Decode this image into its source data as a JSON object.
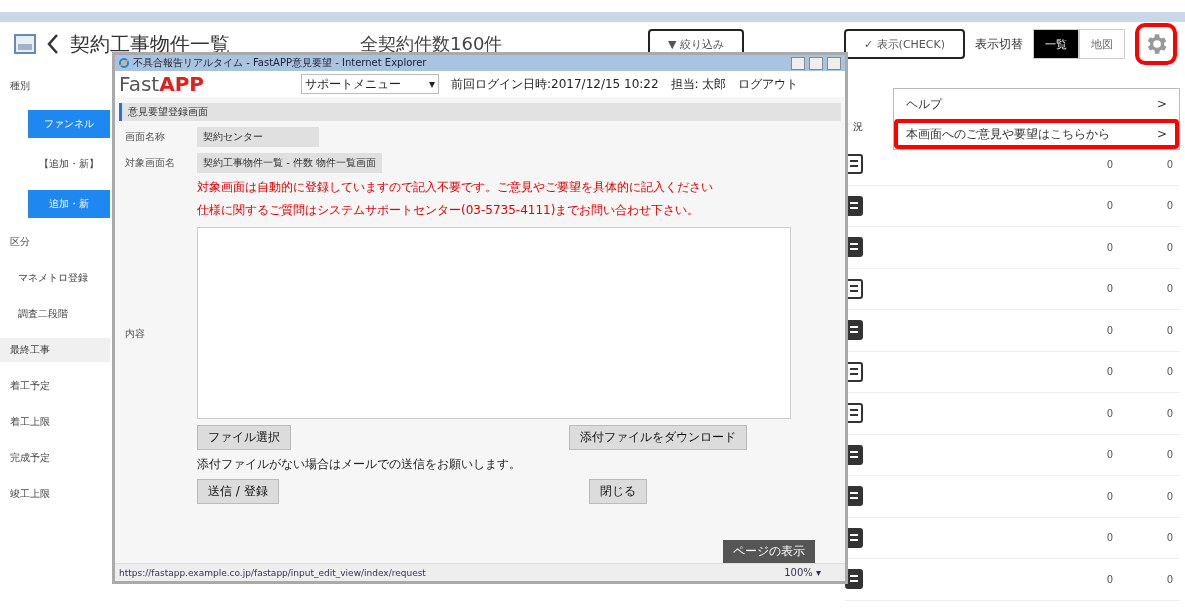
{
  "header": {
    "title": "契約工事物件一覧",
    "count": "全契約件数160件",
    "filter_button": "▼ 絞り込み",
    "check_button": "✓ 表示(CHECK)",
    "view_label": "表示切替",
    "view_options": [
      {
        "label": "一覧",
        "selected": true
      },
      {
        "label": "地図",
        "selected": false
      }
    ],
    "settings_highlighted": true
  },
  "sidebar": [
    {
      "kind": "heading",
      "label": "種別",
      "selected": false,
      "highlighted": false
    },
    {
      "kind": "option",
      "label": "ファンネル",
      "selected": true,
      "highlighted": false
    },
    {
      "kind": "option",
      "label": "【追加・新】",
      "selected": false,
      "highlighted": false
    },
    {
      "kind": "option",
      "label": "追加・新",
      "selected": true,
      "highlighted": false
    },
    {
      "kind": "heading",
      "label": "区分",
      "selected": false,
      "highlighted": false
    },
    {
      "kind": "sub",
      "label": "マネメトロ登録",
      "selected": false,
      "highlighted": false
    },
    {
      "kind": "sub",
      "label": "調査二段階",
      "selected": false,
      "highlighted": false
    },
    {
      "kind": "heading",
      "label": "最終工事",
      "selected": false,
      "highlighted": true
    },
    {
      "kind": "heading",
      "label": "着工予定",
      "selected": false,
      "highlighted": false
    },
    {
      "kind": "heading",
      "label": "着工上限",
      "selected": false,
      "highlighted": false
    },
    {
      "kind": "heading",
      "label": "完成予定",
      "selected": false,
      "highlighted": false
    },
    {
      "kind": "heading",
      "label": "竣工上限",
      "selected": false,
      "highlighted": false
    }
  ],
  "table": {
    "column_1": "況",
    "rows": [
      {
        "kind": "outline",
        "value_1": "0",
        "value_2": "0"
      },
      {
        "kind": "filled",
        "value_1": "0",
        "value_2": "0"
      },
      {
        "kind": "filled",
        "value_1": "0",
        "value_2": "0"
      },
      {
        "kind": "outline",
        "value_1": "0",
        "value_2": "0"
      },
      {
        "kind": "filled",
        "value_1": "0",
        "value_2": "0"
      },
      {
        "kind": "outline",
        "value_1": "0",
        "value_2": "0"
      },
      {
        "kind": "outline",
        "value_1": "0",
        "value_2": "0"
      },
      {
        "kind": "filled",
        "value_1": "0",
        "value_2": "0"
      },
      {
        "kind": "filled",
        "value_1": "0",
        "value_2": "0"
      },
      {
        "kind": "filled",
        "value_1": "0",
        "value_2": "0"
      },
      {
        "kind": "filled",
        "value_1": "0",
        "value_2": "0"
      }
    ]
  },
  "menu": [
    {
      "label": "ヘルプ",
      "chevron": ">",
      "highlighted": false
    },
    {
      "label": "本画面へのご意見や要望はこちらから",
      "chevron": ">",
      "highlighted": true
    }
  ],
  "popup": {
    "title": "不具合報告リアルタイム - FastAPP意見要望 - Internet Explorer",
    "logo_light": "Fast",
    "logo_bold": "APP",
    "menu_select": "サポートメニュー",
    "menu_select_arrow": "▾",
    "last_login": "前回ログイン日時:2017/12/15 10:22",
    "user": "担当: 太郎",
    "logout": "ログアウト",
    "section": "意見要望登録画面",
    "fields": [
      {
        "label": "画面名称",
        "value": "契約センター"
      },
      {
        "label": "対象画面名",
        "value": "契約工事物件一覧 - 件数 物件一覧画面"
      }
    ],
    "notices": [
      "対象画面は自動的に登録していますので記入不要です。ご意見やご要望を具体的に記入ください",
      "仕様に関するご質問はシステムサポートセンター(03-5735-4111)までお問い合わせ下さい。"
    ],
    "content_label": "内容",
    "file_button": "ファイル選択",
    "download_button": "添付ファイルをダウンロード",
    "file_note": "添付ファイルがない場合はメールでの送信をお願いします。",
    "submit_button": "送信 / 登録",
    "close_button": "閉じる",
    "page_button": "ページの表示",
    "url": "https://fastapp.example.co.jp/fastapp/input_edit_view/index/request",
    "zoom": "100%",
    "zoom_arrow": "▾"
  }
}
